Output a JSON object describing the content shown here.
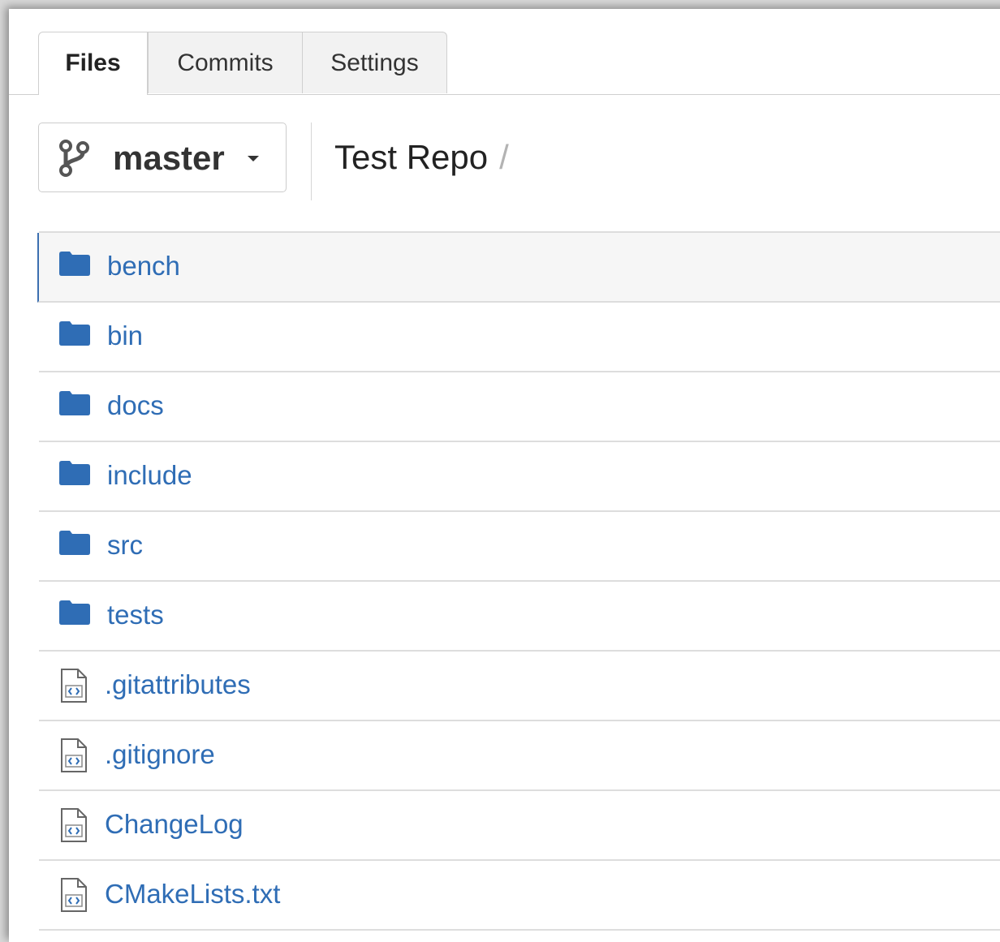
{
  "tabs": [
    {
      "label": "Files"
    },
    {
      "label": "Commits"
    },
    {
      "label": "Settings"
    }
  ],
  "branch": {
    "name": "master",
    "icon": "git-branch-icon"
  },
  "breadcrumb": {
    "repo": "Test Repo",
    "separator": "/"
  },
  "files": [
    {
      "name": "bench",
      "type": "folder",
      "icon": "folder-icon"
    },
    {
      "name": "bin",
      "type": "folder",
      "icon": "folder-icon"
    },
    {
      "name": "docs",
      "type": "folder",
      "icon": "folder-icon"
    },
    {
      "name": "include",
      "type": "folder",
      "icon": "folder-icon"
    },
    {
      "name": "src",
      "type": "folder",
      "icon": "folder-icon"
    },
    {
      "name": "tests",
      "type": "folder",
      "icon": "folder-icon"
    },
    {
      "name": ".gitattributes",
      "type": "file",
      "icon": "code-file-icon"
    },
    {
      "name": ".gitignore",
      "type": "file",
      "icon": "code-file-icon"
    },
    {
      "name": "ChangeLog",
      "type": "file",
      "icon": "code-file-icon"
    },
    {
      "name": "CMakeLists.txt",
      "type": "file",
      "icon": "code-file-icon"
    }
  ],
  "colors": {
    "link": "#2f6db5",
    "folder": "#2f6db5",
    "selected_accent": "#3c6fb0"
  }
}
